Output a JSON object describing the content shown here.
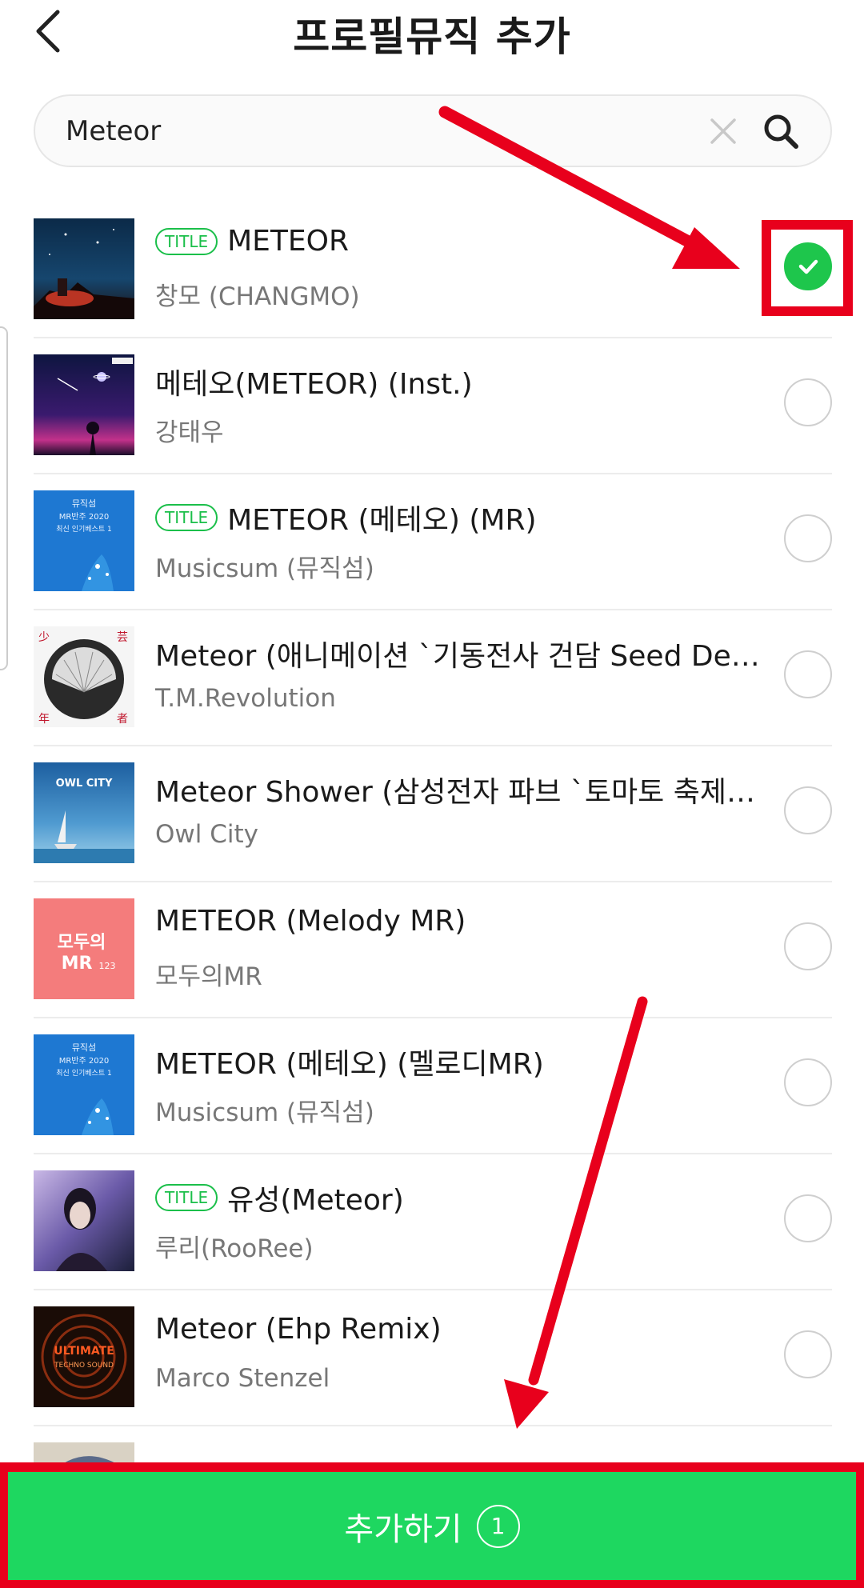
{
  "header": {
    "title": "프로필뮤직 추가",
    "back_icon": "chevron-left-icon"
  },
  "search": {
    "value": "Meteor",
    "clear_icon": "close-icon",
    "search_icon": "search-icon"
  },
  "songs": [
    {
      "title": "METEOR",
      "artist": "창모 (CHANGMO)",
      "badge": "TITLE",
      "selected": true,
      "art": "night-sky-fire"
    },
    {
      "title": "메테오(METEOR) (Inst.)",
      "artist": "강태우",
      "badge": "",
      "selected": false,
      "art": "purple-galaxy"
    },
    {
      "title": "METEOR (메테오) (MR)",
      "artist": "Musicsum (뮤직섬)",
      "badge": "TITLE",
      "selected": false,
      "art": "blue-musicsum"
    },
    {
      "title": "Meteor (애니메이션 `기동전사 건담 Seed De…",
      "artist": "T.M.Revolution",
      "badge": "",
      "selected": false,
      "art": "fan-circle"
    },
    {
      "title": "Meteor Shower (삼성전자 파브 `토마토 축제…",
      "artist": "Owl City",
      "badge": "",
      "selected": false,
      "art": "owl-city-boat"
    },
    {
      "title": "METEOR (Melody MR)",
      "artist": "모두의MR",
      "badge": "",
      "selected": false,
      "art": "pink-mr"
    },
    {
      "title": "METEOR (메테오) (멜로디MR)",
      "artist": "Musicsum (뮤직섬)",
      "badge": "",
      "selected": false,
      "art": "blue-musicsum"
    },
    {
      "title": "유성(Meteor)",
      "artist": "루리(RooRee)",
      "badge": "TITLE",
      "selected": false,
      "art": "portrait"
    },
    {
      "title": "Meteor (Ehp Remix)",
      "artist": "Marco Stenzel",
      "badge": "",
      "selected": false,
      "art": "ultimate-techno"
    }
  ],
  "album_art_text": {
    "musicsum": [
      "뮤직섬",
      "MR반주 2020",
      "최신 인기베스트 1"
    ],
    "owl_city": "OWL CITY",
    "pink_mr": [
      "모두의",
      "MR",
      "123"
    ],
    "techno": [
      "ULTIMATE",
      "TECHNO SOUND"
    ],
    "fan": [
      "少",
      "芸",
      "年",
      "者"
    ]
  },
  "footer": {
    "add_label": "추가하기",
    "selected_count": "1"
  },
  "colors": {
    "accent_green": "#1ed760",
    "check_green": "#1ec64c",
    "annotation_red": "#e8001c"
  }
}
